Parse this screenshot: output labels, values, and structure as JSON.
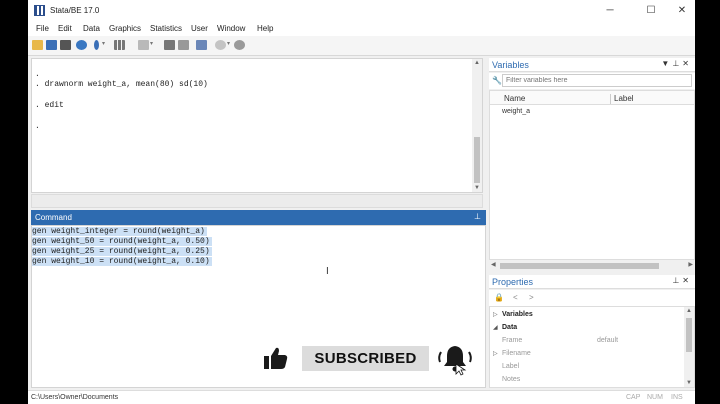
{
  "window": {
    "title": "Stata/BE 17.0"
  },
  "menu": [
    "File",
    "Edit",
    "Data",
    "Graphics",
    "Statistics",
    "User",
    "Window",
    "Help"
  ],
  "results": {
    "lines": [
      ". ",
      ". drawnorm weight_a, mean(80) sd(10)",
      ". edit",
      ". "
    ]
  },
  "command": {
    "title": "Command",
    "lines": [
      "gen weight_integer = round(weight_a)",
      "gen weight_50 = round(weight_a, 0.50)",
      "gen weight_25 = round(weight_a, 0.25)",
      "gen weight_10 = round(weight_a, 0.10)"
    ]
  },
  "overlay": {
    "subscribe_label": "SUBSCRIBED"
  },
  "variables": {
    "title": "Variables",
    "filter_placeholder": "Filter variables here",
    "col_name": "Name",
    "col_label": "Label",
    "rows": [
      {
        "name": "weight_a",
        "label": ""
      }
    ]
  },
  "properties": {
    "title": "Properties",
    "sections": [
      {
        "label": "Variables",
        "expanded": false
      },
      {
        "label": "Data",
        "expanded": true
      }
    ],
    "items": [
      {
        "key": "Frame",
        "value": "default",
        "expandable": false
      },
      {
        "key": "Filename",
        "value": "",
        "expandable": true
      },
      {
        "key": "Label",
        "value": "",
        "expandable": false
      },
      {
        "key": "Notes",
        "value": "",
        "expandable": false
      }
    ]
  },
  "status": {
    "path": "C:\\Users\\Owner\\Documents",
    "indicators": [
      "CAP",
      "NUM",
      "INS"
    ]
  },
  "colors": {
    "accent": "#2e6bb0",
    "selection": "#cce0f5"
  }
}
